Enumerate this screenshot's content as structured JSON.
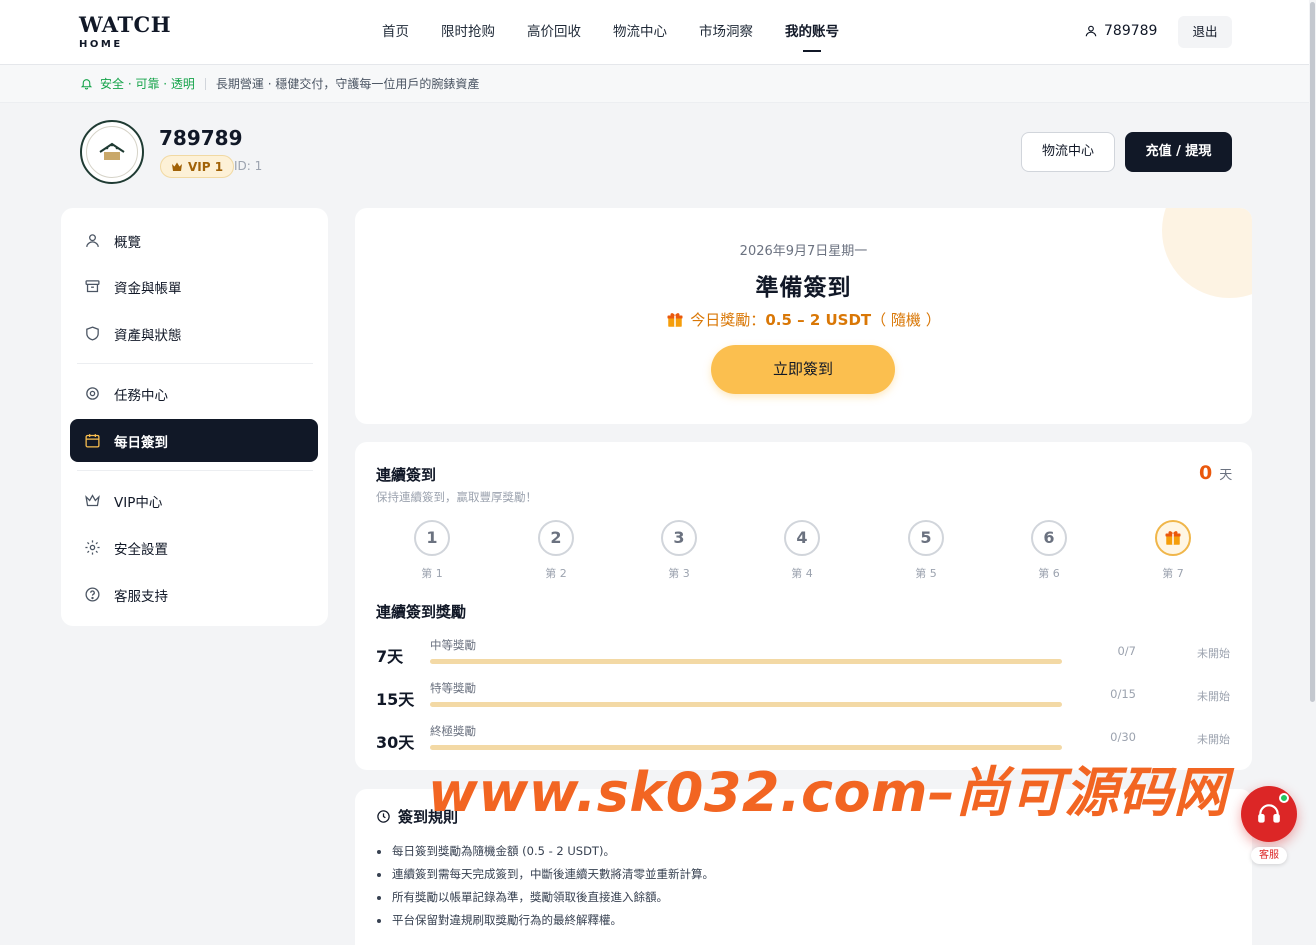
{
  "header": {
    "logo_line1": "WATCH",
    "logo_line2": "HOME",
    "nav": [
      {
        "label": "首页"
      },
      {
        "label": "限时抢购"
      },
      {
        "label": "高价回收"
      },
      {
        "label": "物流中心"
      },
      {
        "label": "市场洞察"
      },
      {
        "label": "我的账号",
        "active": true
      }
    ],
    "username": "789789",
    "logout_label": "退出"
  },
  "notice": {
    "trust_label": "安全 · 可靠 · 透明",
    "motto": "長期營運 · 穩健交付，守護每一位用戶的腕錶資產"
  },
  "profile": {
    "name": "789789",
    "vip": "VIP 1",
    "id_text": "ID: 1",
    "logistics_label": "物流中心",
    "recharge_label": "充值 / 提現"
  },
  "sidebar": {
    "items": [
      {
        "label": "概覽",
        "icon": "user-icon"
      },
      {
        "label": "資金與帳單",
        "icon": "archive-icon"
      },
      {
        "label": "資產與狀態",
        "icon": "shield-icon"
      },
      {
        "label": "任務中心",
        "icon": "target-icon"
      },
      {
        "label": "每日簽到",
        "icon": "calendar-icon",
        "active": true
      },
      {
        "label": "VIP中心",
        "icon": "crown-icon"
      },
      {
        "label": "安全設置",
        "icon": "gear-icon"
      },
      {
        "label": "客服支持",
        "icon": "help-icon"
      }
    ]
  },
  "checkin": {
    "date": "2026年9月7日星期一",
    "title": "準備簽到",
    "reward_prefix": "今日獎勵：",
    "reward_amount": "0.5 – 2 USDT",
    "reward_suffix": "（ 隨機 ）",
    "button_label": "立即簽到"
  },
  "streak": {
    "title": "連續簽到",
    "subtitle": "保持連續簽到，贏取豐厚獎勵！",
    "count": "0",
    "unit": "天",
    "days": [
      {
        "num": "1",
        "label": "第 1"
      },
      {
        "num": "2",
        "label": "第 2"
      },
      {
        "num": "3",
        "label": "第 3"
      },
      {
        "num": "4",
        "label": "第 4"
      },
      {
        "num": "5",
        "label": "第 5"
      },
      {
        "num": "6",
        "label": "第 6"
      },
      {
        "num": "",
        "label": "第 7",
        "icon": "gift-icon"
      }
    ],
    "rewards_title": "連續簽到獎勵",
    "rewards": [
      {
        "days": "7天",
        "name": "中等獎勵",
        "progress": "0/7",
        "status": "未開始",
        "fraction": 0
      },
      {
        "days": "15天",
        "name": "特等獎勵",
        "progress": "0/15",
        "status": "未開始",
        "fraction": 0
      },
      {
        "days": "30天",
        "name": "終極獎勵",
        "progress": "0/30",
        "status": "未開始",
        "fraction": 0
      }
    ]
  },
  "rules": {
    "title": "簽到規則",
    "items": [
      "每日簽到獎勵為隨機金額 (0.5 - 2 USDT)。",
      "連續簽到需每天完成簽到，中斷後連續天數將清零並重新計算。",
      "所有獎勵以帳單記錄為準，獎勵領取後直接進入餘額。",
      "平台保留對違規刷取獎勵行為的最終解釋權。"
    ]
  },
  "watermark": "www.sk032.com–尚可源码网",
  "support": {
    "label": "客服"
  },
  "colors": {
    "accent": "#fbbf4f",
    "dark": "#111827",
    "trust": "#16a34a",
    "streak": "#ea580c"
  }
}
